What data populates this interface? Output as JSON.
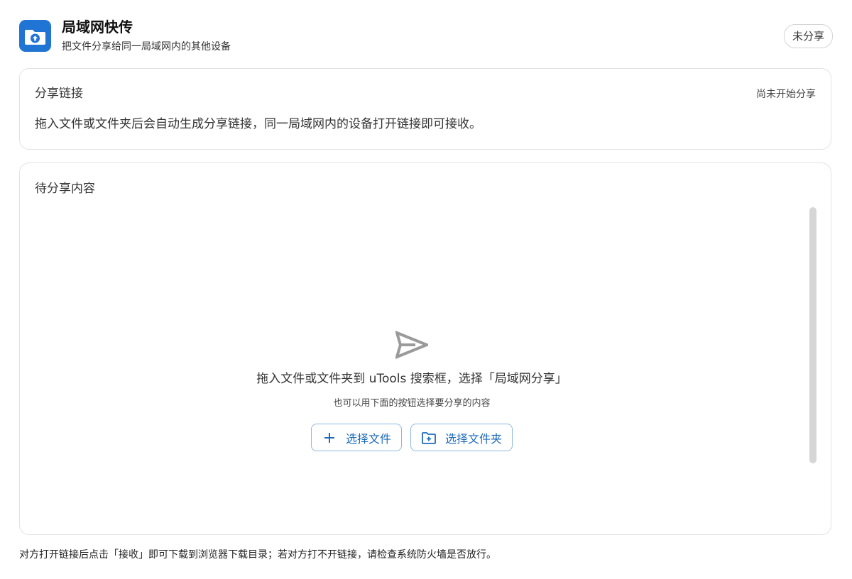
{
  "header": {
    "title": "局域网快传",
    "subtitle": "把文件分享给同一局域网内的其他设备",
    "status": "未分享",
    "logo_icon": "folder-upload-icon",
    "accent_color": "#1f74d4"
  },
  "share_link": {
    "title": "分享链接",
    "status": "尚未开始分享",
    "description": "拖入文件或文件夹后会自动生成分享链接，同一局域网内的设备打开链接即可接收。"
  },
  "pending": {
    "title": "待分享内容",
    "empty_icon": "send-icon",
    "empty_main": "拖入文件或文件夹到 uTools 搜索框，选择「局域网分享」",
    "empty_sub": "也可以用下面的按钮选择要分享的内容",
    "buttons": [
      {
        "label": "选择文件",
        "icon": "plus-icon"
      },
      {
        "label": "选择文件夹",
        "icon": "folder-add-icon"
      }
    ]
  },
  "footer": {
    "note": "对方打开链接后点击「接收」即可下载到浏览器下载目录；若对方打不开链接，请检查系统防火墙是否放行。"
  }
}
